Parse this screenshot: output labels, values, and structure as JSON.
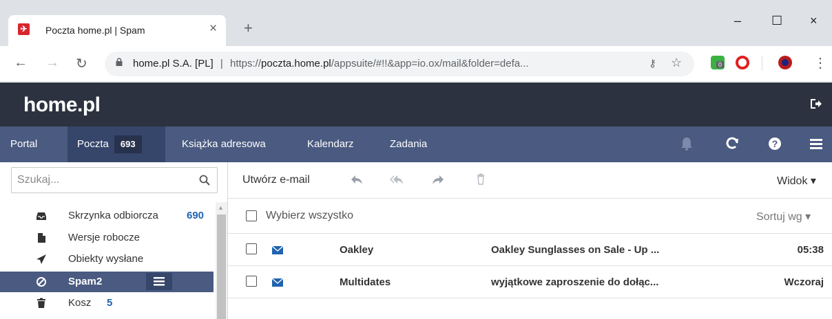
{
  "browser": {
    "tab_title": "Poczta home.pl | Spam",
    "favicon_glyph": "✈",
    "close_glyph": "×",
    "newtab_glyph": "+",
    "window_minimize": "–",
    "window_maximize": "☐",
    "window_close": "×",
    "back_glyph": "←",
    "forward_glyph": "→",
    "reload_glyph": "↻",
    "site_identity": "home.pl S.A. [PL]",
    "url_prefix": "https://",
    "url_host": "poczta.home.pl",
    "url_path": "/appsuite/#!!&app=io.ox/mail&folder=defa...",
    "key_glyph": "⚷",
    "star_glyph": "☆",
    "menu_glyph": "⋮",
    "extension_badge": "0"
  },
  "app": {
    "logo": "home.pl",
    "nav": {
      "portal": "Portal",
      "mail": "Poczta",
      "mail_count": "693",
      "contacts": "Książka adresowa",
      "calendar": "Kalendarz",
      "tasks": "Zadania"
    }
  },
  "sidebar": {
    "search_placeholder": "Szukaj...",
    "folders": [
      {
        "label": "Skrzynka odbiorcza",
        "count": "690",
        "icon": "inbox-icon"
      },
      {
        "label": "Wersje robocze",
        "count": "",
        "icon": "drafts-icon"
      },
      {
        "label": "Obiekty wysłane",
        "count": "",
        "icon": "sent-icon"
      },
      {
        "label": "Spam",
        "count": "2",
        "icon": "spam-icon"
      },
      {
        "label": "Kosz",
        "count": "5",
        "icon": "trash-icon"
      }
    ]
  },
  "toolbar": {
    "compose": "Utwórz e-mail",
    "view": "Widok ▾"
  },
  "list": {
    "select_all": "Wybierz wszystko",
    "sort": "Sortuj wg ▾",
    "messages": [
      {
        "from": "Oakley",
        "subject": "Oakley Sunglasses on Sale - Up ...",
        "time": "05:38"
      },
      {
        "from": "Multidates",
        "subject": "wyjątkowe zaproszenie do dołąc...",
        "time": "Wczoraj"
      }
    ]
  },
  "colors": {
    "header": "#2c3240",
    "nav": "#4a5a80",
    "nav_active": "#36456a",
    "count_blue": "#2063b0"
  }
}
